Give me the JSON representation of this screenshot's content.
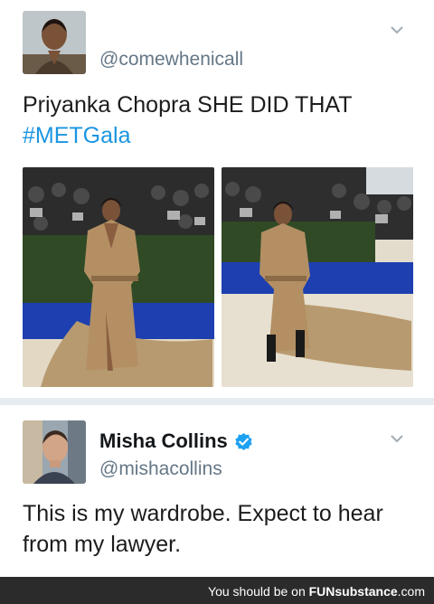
{
  "tweet1": {
    "handle": "@comewhenicall",
    "text_line1": "Priyanka Chopra SHE DID THAT",
    "hashtag": "#METGala",
    "images": [
      "red-carpet-photo-front",
      "red-carpet-photo-side"
    ]
  },
  "tweet2": {
    "name": "Misha Collins",
    "handle": "@mishacollins",
    "text_line1": "This is my wardrobe. Expect to hear",
    "text_line2": "from my lawyer."
  },
  "footer": {
    "prefix": "You should be on ",
    "brand": "FUNsubstance",
    "suffix": ".com"
  },
  "colors": {
    "hashtag": "#1b95e0",
    "handle": "#657786",
    "verified": "#1da1f2",
    "divider": "#e6ecf0",
    "footer_bg": "#2b2b2b"
  },
  "icons": [
    "caret-down-icon",
    "verified-badge-icon"
  ]
}
